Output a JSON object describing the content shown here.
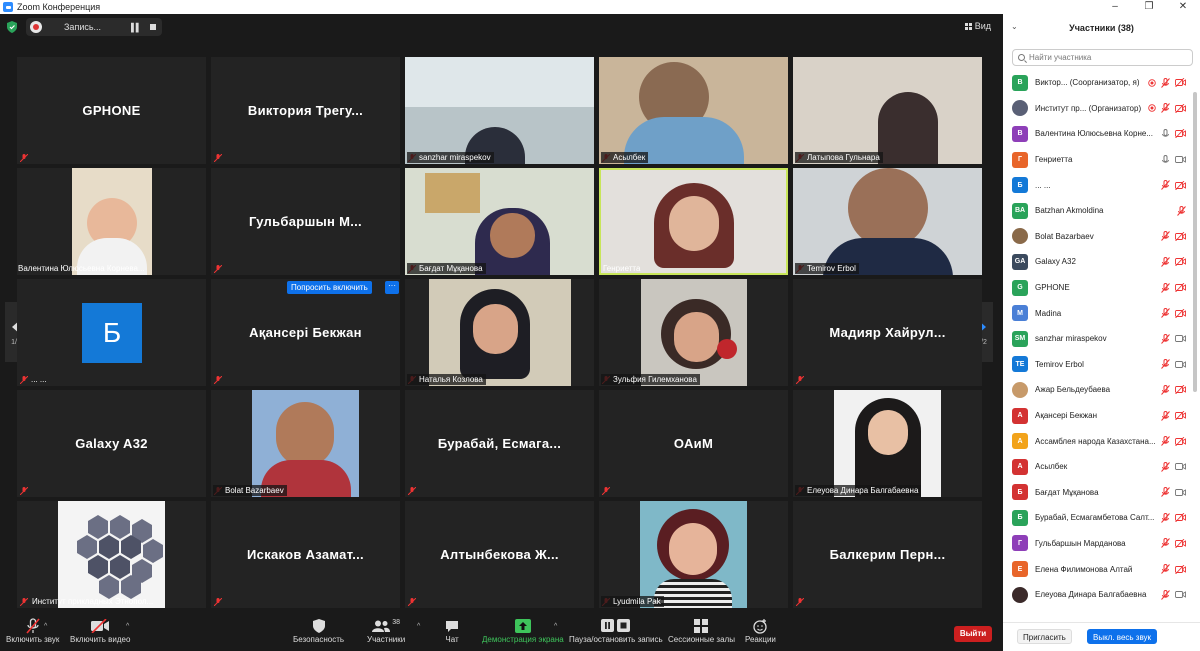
{
  "window": {
    "title": "Zoom Конференция"
  },
  "topbar": {
    "recording_label": "Запись...",
    "view_label": "Вид"
  },
  "gallery": {
    "page_indicator_left": "1/2",
    "page_indicator_right": "1/2",
    "ask_unmute_label": "Попросить включить",
    "more_label": "···",
    "tiles": [
      {
        "name": "GPHONE",
        "caption": "",
        "kind": "name"
      },
      {
        "name": "Виктория  Трегу...",
        "caption": "",
        "kind": "name"
      },
      {
        "name": "",
        "caption": "sanzhar miraspekov",
        "kind": "video"
      },
      {
        "name": "",
        "caption": "Асылбек",
        "kind": "video"
      },
      {
        "name": "",
        "caption": "Латыпова Гульнара",
        "kind": "video"
      },
      {
        "name": "",
        "caption": "Валентина Юлюсьевна Корнева...",
        "kind": "video"
      },
      {
        "name": "Гульбаршын  М...",
        "caption": "",
        "kind": "name"
      },
      {
        "name": "",
        "caption": "Бағдат Мұқанова",
        "kind": "video"
      },
      {
        "name": "",
        "caption": "Генриетта",
        "kind": "video"
      },
      {
        "name": "",
        "caption": "Temirov Erbol",
        "kind": "video"
      },
      {
        "name": "Б",
        "caption": "... ...",
        "kind": "avatar"
      },
      {
        "name": "Ақансері Бекжан",
        "caption": "",
        "kind": "name"
      },
      {
        "name": "",
        "caption": "Наталья Козлова",
        "kind": "video"
      },
      {
        "name": "",
        "caption": "Зульфия Гилемханова",
        "kind": "video"
      },
      {
        "name": "Мадияр  Хайрул...",
        "caption": "",
        "kind": "name"
      },
      {
        "name": "Galaxy A32",
        "caption": "",
        "kind": "name"
      },
      {
        "name": "",
        "caption": "Bolat Bazarbaev",
        "kind": "video"
      },
      {
        "name": "Бурабай,  Есмага...",
        "caption": "",
        "kind": "name"
      },
      {
        "name": "ОАиМ",
        "caption": "",
        "kind": "name"
      },
      {
        "name": "",
        "caption": "Елеуова Динара Балгабаевна",
        "kind": "video"
      },
      {
        "name": "",
        "caption": "Институт прикладных Этнопол...",
        "kind": "video"
      },
      {
        "name": "Искаков  Азамат...",
        "caption": "",
        "kind": "name"
      },
      {
        "name": "Алтынбекова  Ж...",
        "caption": "",
        "kind": "name"
      },
      {
        "name": "",
        "caption": "Lyudmila Pak",
        "kind": "video"
      },
      {
        "name": "Балкерим  Перн...",
        "caption": "",
        "kind": "name"
      }
    ]
  },
  "toolbar": {
    "unmute": "Включить звук",
    "start_video": "Включить видео",
    "security": "Безопасность",
    "participants": "Участники",
    "participants_count": "38",
    "chat": "Чат",
    "share": "Демонстрация экрана",
    "record": "Пауза/остановить запись",
    "breakout": "Сессионные залы",
    "reactions": "Реакции",
    "leave": "Выйти"
  },
  "panel": {
    "title": "Участники (38)",
    "search_placeholder": "Найти участника",
    "invite": "Пригласить",
    "mute_all": "Выкл. весь звук",
    "participants": [
      {
        "initials": "В",
        "color": "#2aa35a",
        "name": "Виктор...  (Соорганизатор, я)"
      },
      {
        "initials": "",
        "color": "#5a6076",
        "name": "Институт пр...  (Организатор)"
      },
      {
        "initials": "В",
        "color": "#8e3fb8",
        "name": "Валентина Юлюсьевна Корне..."
      },
      {
        "initials": "Г",
        "color": "#e8652a",
        "name": "Генриетта"
      },
      {
        "initials": "Б",
        "color": "#1479d7",
        "name": "... ..."
      },
      {
        "initials": "BA",
        "color": "#2aa35a",
        "name": "Batzhan Akmoldina"
      },
      {
        "initials": "",
        "color": "#8a6a4a",
        "name": "Bolat Bazarbaev"
      },
      {
        "initials": "GA",
        "color": "#3b4a5e",
        "name": "Galaxy A32"
      },
      {
        "initials": "G",
        "color": "#2aa35a",
        "name": "GPHONE"
      },
      {
        "initials": "M",
        "color": "#4a7fd6",
        "name": "Madina"
      },
      {
        "initials": "SM",
        "color": "#2aa35a",
        "name": "sanzhar miraspekov"
      },
      {
        "initials": "TE",
        "color": "#1479d7",
        "name": "Temirov Erbol"
      },
      {
        "initials": "",
        "color": "#c79a6a",
        "name": "Ажар Бельдеубаева"
      },
      {
        "initials": "А",
        "color": "#d33232",
        "name": "Ақансері Бекжан"
      },
      {
        "initials": "А",
        "color": "#f2a31b",
        "name": "Ассамблея народа Казахстана..."
      },
      {
        "initials": "А",
        "color": "#d33232",
        "name": "Асылбек"
      },
      {
        "initials": "Б",
        "color": "#d33232",
        "name": "Бағдат Мұқанова"
      },
      {
        "initials": "Б",
        "color": "#2aa35a",
        "name": "Бурабай, Есмагамбетова Салт..."
      },
      {
        "initials": "Г",
        "color": "#8e3fb8",
        "name": "Гульбаршын Марданова"
      },
      {
        "initials": "Е",
        "color": "#e8652a",
        "name": "Елена Филимонова Алтай"
      },
      {
        "initials": "",
        "color": "#3b2a2a",
        "name": "Елеуова Динара Балгабаевна"
      }
    ]
  }
}
